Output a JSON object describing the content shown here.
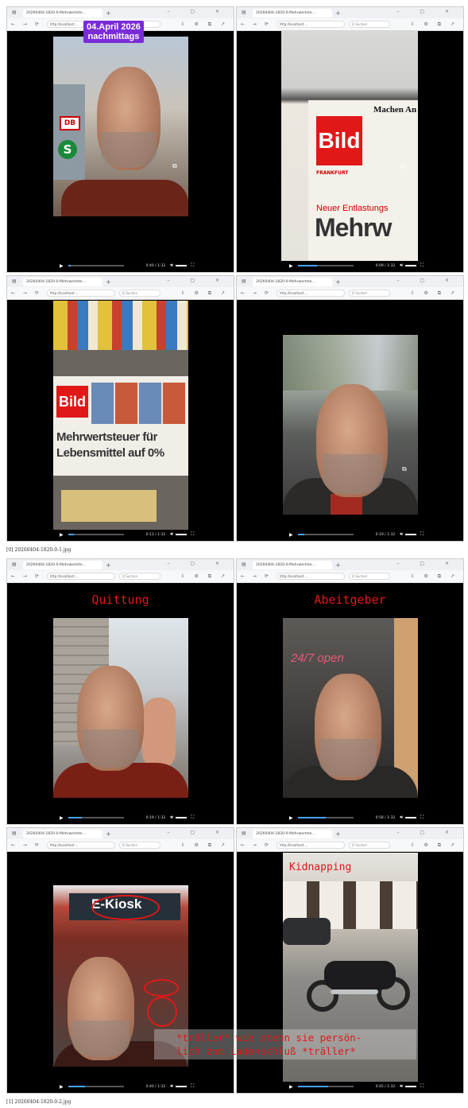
{
  "captions": [
    "[0] 20260404-1820-0-1.jpg",
    "[1] 20260404-1820-0-2.jpg"
  ],
  "browser": {
    "tab_title": "20260404-1820-0-Mehrwertste…",
    "address": "http://localhost:…",
    "search_placeholder": "Q Suchen",
    "new_tab": "+",
    "window_controls": "– ▢ ×"
  },
  "sheet1": {
    "w1": {
      "date_line1": "04.April 2026",
      "date_line2": "nachmittags",
      "time": "0:40 / 1:32",
      "progress": 0.05
    },
    "w2": {
      "time": "0:09 / 1:32",
      "progress": 0.35,
      "bild": "Bild",
      "headline_partial": "Mehrw",
      "subhead": "Neuer Entlastungs",
      "right_head": "Machen An",
      "city": "FRANKFURT"
    },
    "w3": {
      "time": "0:13 / 1:32",
      "progress": 0.1,
      "bild": "Bild",
      "headline_line1": "Mehrwertsteuer für",
      "headline_line2": "Lebensmittel auf 0%"
    },
    "w4": {
      "time": "0:19 / 1:32",
      "progress": 0.12
    }
  },
  "sheet2": {
    "w1": {
      "title": "Quittung",
      "time": "0:19 / 1:32",
      "progress": 0.25
    },
    "w2": {
      "title": "Abeitgeber",
      "time": "0:58 / 1:32",
      "progress": 0.5,
      "sign": "24/7 open"
    },
    "w3": {
      "time": "0:40 / 1:32",
      "progress": 0.3,
      "sign": "E-Kiosk"
    },
    "w4": {
      "title": "Kidnapping",
      "time": "0:45 / 1:32",
      "progress": 0.55
    },
    "overlay_line1": "*träller* wie stehn sie persön-",
    "overlay_line2": "lich zum Ladenschluß *träller*"
  },
  "colors": {
    "accent_red": "#e01818",
    "date_purple": "#7a2cd8",
    "seek_blue": "#4aa3ff"
  }
}
